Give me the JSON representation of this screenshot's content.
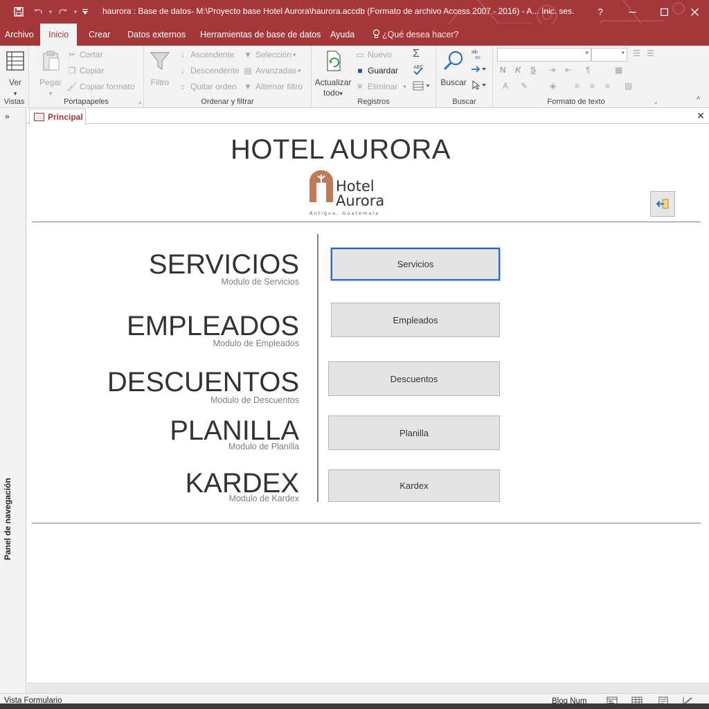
{
  "window": {
    "title": "haurora : Base de datos- M:\\Proyecto base Hotel Aurora\\haurora.accdb (Formato de archivo Access 2007 - 2016)  -  A...",
    "signin": "Inic. ses.",
    "help": "?",
    "accent_color": "#a4373a"
  },
  "menu": {
    "tabs": [
      {
        "label": "Archivo"
      },
      {
        "label": "Inicio"
      },
      {
        "label": "Crear"
      },
      {
        "label": "Datos externos"
      },
      {
        "label": "Herramientas de base de datos"
      },
      {
        "label": "Ayuda"
      }
    ],
    "active_tab": "Inicio",
    "tell_me": "¿Qué desea hacer?"
  },
  "ribbon": {
    "vistas": {
      "label": "Vistas",
      "ver": "Ver"
    },
    "portapapeles": {
      "label": "Portapapeles",
      "pegar": "Pegar",
      "cortar": "Cortar",
      "copiar": "Copiar",
      "copiar_formato": "Copiar formato"
    },
    "ordenar": {
      "label": "Ordenar y filtrar",
      "filtro": "Filtro",
      "ascendente": "Ascendente",
      "descendente": "Descendente",
      "quitar_orden": "Quitar orden",
      "seleccion": "Selección",
      "avanzadas": "Avanzadas",
      "alternar": "Alternar filtro"
    },
    "registros": {
      "label": "Registros",
      "actualizar": "Actualizar",
      "todo": "todo",
      "nuevo": "Nuevo",
      "guardar": "Guardar",
      "eliminar": "Eliminar"
    },
    "buscar": {
      "label": "Buscar",
      "buscar": "Buscar"
    },
    "formato": {
      "label": "Formato de texto",
      "bold": "N",
      "italic": "K",
      "underline": "S",
      "font_color": "A"
    }
  },
  "navpane": {
    "label": "Panel de navegación",
    "toggle": "»"
  },
  "document": {
    "tab_label": "Principal"
  },
  "form": {
    "title": "HOTEL AURORA",
    "logo": {
      "line1": "Hotel",
      "line2": "Aurora",
      "tagline": "Antigua, Guatemala"
    },
    "modules": [
      {
        "title": "SERVICIOS",
        "subtitle": "Modulo de Servicios",
        "button": "Servicios"
      },
      {
        "title": "EMPLEADOS",
        "subtitle": "Modulo de Empleados",
        "button": "Empleados"
      },
      {
        "title": "DESCUENTOS",
        "subtitle": "Modulo de Descuentos",
        "button": "Descuentos"
      },
      {
        "title": "PLANILLA",
        "subtitle": "Modulo de Planilla",
        "button": "Planilla"
      },
      {
        "title": "KARDEX",
        "subtitle": "Modulo de Kardex",
        "button": "Kardex"
      }
    ]
  },
  "status": {
    "left": "Vista Formulario",
    "right": "Bloq Num"
  }
}
